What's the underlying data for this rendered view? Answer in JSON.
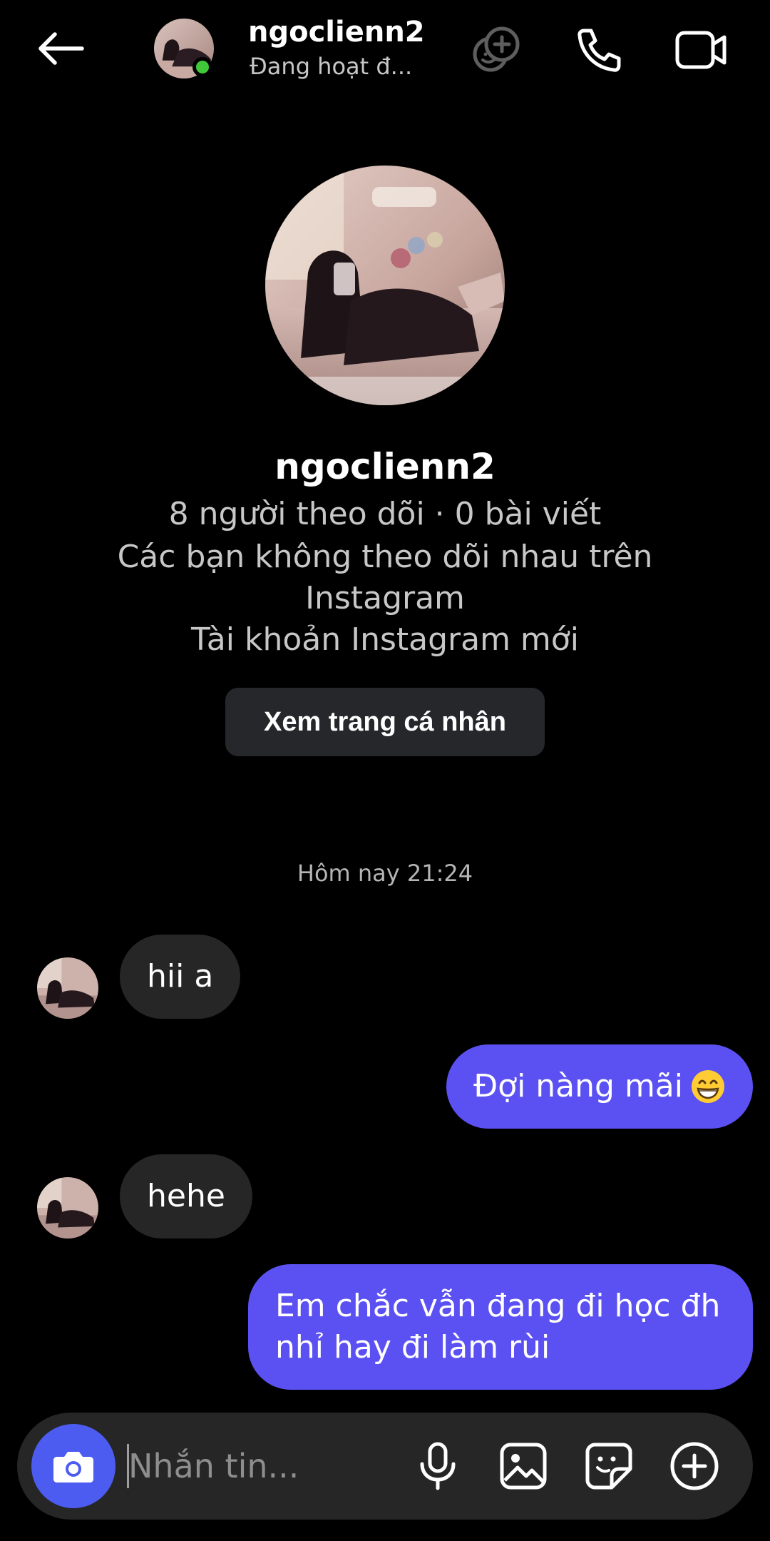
{
  "header": {
    "name": "ngoclienn2",
    "status": "Đang hoạt đ..."
  },
  "profile": {
    "name": "ngoclienn2",
    "stats": "8 người theo dõi · 0 bài viết",
    "not_following": "Các bạn không theo dõi nhau trên Instagram",
    "new_account": "Tài khoản Instagram mới",
    "view_profile_label": "Xem trang cá nhân"
  },
  "conversation": {
    "timestamp": "Hôm nay 21:24",
    "messages": [
      {
        "direction": "incoming",
        "text": "hii a"
      },
      {
        "direction": "outgoing",
        "text": "Đợi nàng mãi",
        "emoji": "grinning-face-with-smiling-eyes"
      },
      {
        "direction": "incoming",
        "text": "hehe"
      },
      {
        "direction": "outgoing",
        "text": "Em chắc vẫn đang đi học đh nhỉ hay đi làm rùi"
      }
    ]
  },
  "composer": {
    "placeholder": "Nhắn tin..."
  },
  "colors": {
    "background": "#000000",
    "outgoing_bubble": "#5b51f3",
    "incoming_bubble": "#262626",
    "camera_button": "#4d5cf0",
    "online_dot": "#41c83a",
    "secondary_text": "#c7c7c7"
  },
  "icons": {
    "back": "arrow-left-icon",
    "effects": "effects-icon",
    "call": "phone-icon",
    "video": "video-camera-icon",
    "camera": "camera-icon",
    "mic": "microphone-icon",
    "gallery": "image-icon",
    "sticker": "sticker-icon",
    "plus": "plus-circle-icon"
  }
}
